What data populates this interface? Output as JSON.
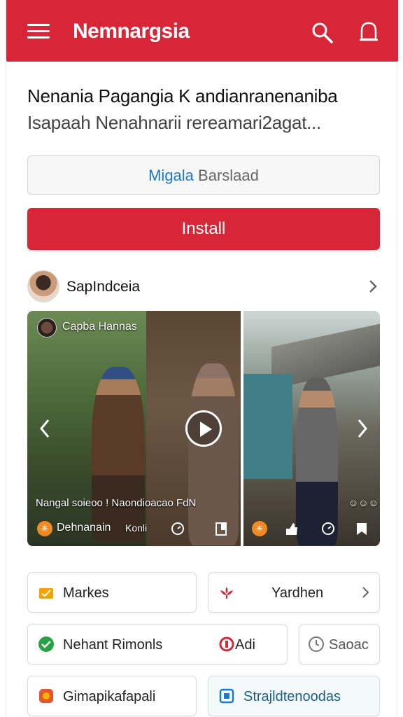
{
  "header": {
    "app_title": "Nemnargsia",
    "background_color": "#d62638",
    "icons": [
      "menu-icon",
      "search-icon",
      "bell-icon"
    ]
  },
  "content": {
    "title": "Nenania Pagangia K andianranenaniba",
    "subtitle": "Isapaah Nenahnarii rereamari2agat..."
  },
  "select": {
    "value_part1": "Migala",
    "value_part2": "Barslaad"
  },
  "install_button": {
    "label": "Install",
    "color": "#d62638"
  },
  "author": {
    "name": "SapIndceia"
  },
  "gallery": {
    "channel_name": "Capba Hannas",
    "caption": "Nangal soieoo ! Naondioacao FdN",
    "author_label": "Dehnanain",
    "author_badge": "Konli",
    "right_badge": "☺☺☺"
  },
  "cards": [
    {
      "label": "Markes",
      "icon": "folder-icon",
      "icon_color": "#f4a300"
    },
    {
      "label": "Yardhen",
      "icon": "lotus-icon",
      "icon_color": "#d62638"
    },
    {
      "label": "Nehant Rimonls",
      "icon": "check-circle-icon",
      "icon_color": "#25a244"
    },
    {
      "label": "Adi",
      "icon": "stop-circle-icon",
      "icon_color": "#d62638"
    },
    {
      "label": "Saoac",
      "icon": "clock-icon",
      "icon_color": "#777777"
    },
    {
      "label": "Gimapikafapali",
      "icon": "app-icon",
      "icon_color": "#e4572e"
    },
    {
      "label": "Strajldtenoodas",
      "icon": "frame-icon",
      "icon_color": "#1c78c9"
    }
  ]
}
